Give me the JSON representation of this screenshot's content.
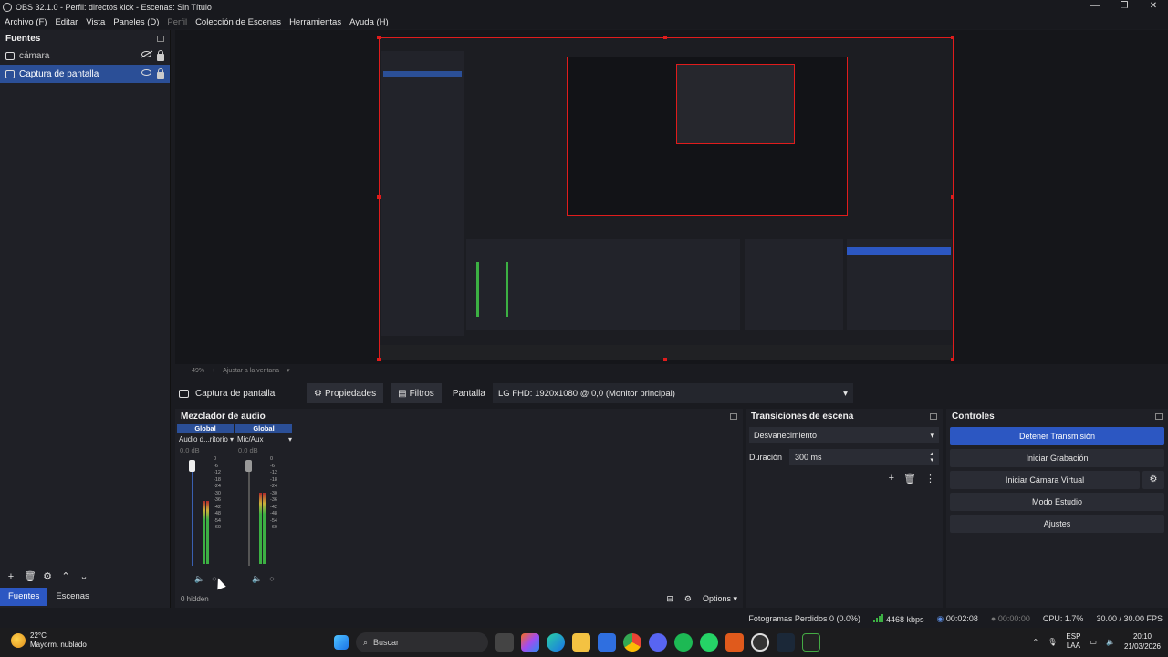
{
  "window": {
    "title": "OBS 32.1.0 - Perfil: directos kick - Escenas: Sin Título",
    "controls": [
      "—",
      "❐",
      "✕"
    ]
  },
  "menu": [
    "Archivo (F)",
    "Editar",
    "Vista",
    "Paneles (D)",
    "Perfil",
    "Colección de Escenas",
    "Herramientas",
    "Ayuda (H)"
  ],
  "sources": {
    "title": "Fuentes",
    "items": [
      {
        "label": "cámara",
        "visible": false,
        "locked": true,
        "selected": false
      },
      {
        "label": "Captura de pantalla",
        "visible": true,
        "locked": true,
        "selected": true
      }
    ]
  },
  "dock_tabs": [
    "Fuentes",
    "Escenas"
  ],
  "preview": {
    "zoom_label": "49%",
    "fit_label": "Ajustar a la ventana"
  },
  "context_bar": {
    "source_name": "Captura de pantalla",
    "properties_label": "Propiedades",
    "filters_label": "Filtros",
    "display_label": "Pantalla",
    "display_value": "LG FHD: 1920x1080 @ 0,0 (Monitor principal)"
  },
  "mixer": {
    "title": "Mezclador de audio",
    "channels": [
      {
        "global": "Global",
        "name": "Audio d...ritorio",
        "db": "0.0 dB",
        "level": 0.62
      },
      {
        "global": "Global",
        "name": "Mic/Aux",
        "db": "0.0 dB",
        "level": 0.7
      }
    ],
    "scale": [
      "0",
      "-6",
      "-12",
      "-18",
      "-24",
      "-30",
      "-36",
      "-42",
      "-48",
      "-54",
      "-60"
    ],
    "hidden_label": "0 hidden",
    "options_label": "Options"
  },
  "transitions": {
    "title": "Transiciones de escena",
    "selected": "Desvanecimiento",
    "duration_label": "Duración",
    "duration_value": "300 ms"
  },
  "controls": {
    "title": "Controles",
    "stop_stream": "Detener Transmisión",
    "start_record": "Iniciar Grabación",
    "start_virtualcam": "Iniciar Cámara Virtual",
    "studio_mode": "Modo Estudio",
    "settings": "Ajustes"
  },
  "status": {
    "dropped": "Fotogramas Perdidos 0 (0.0%)",
    "kbps": "4468 kbps",
    "stream_time": "00:02:08",
    "record_time": "00:00:00",
    "cpu": "CPU: 1.7%",
    "fps": "30.00 / 30.00 FPS"
  },
  "taskbar": {
    "weather_temp": "22°C",
    "weather_desc": "Mayorm. nublado",
    "search_placeholder": "Buscar",
    "lang_top": "ESP",
    "lang_bottom": "LAA",
    "time": "20:10",
    "date": "21/03/2026"
  },
  "colors": {
    "accent": "#2c57c2",
    "selection": "#2b4f97",
    "preview_border": "#e01c1c",
    "meter_green": "#3cb043"
  }
}
